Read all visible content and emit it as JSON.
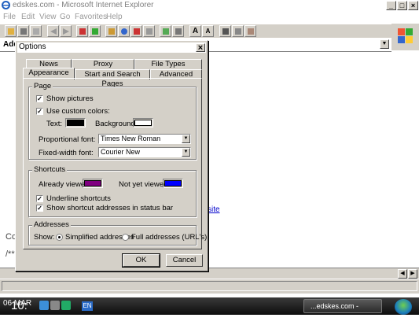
{
  "window": {
    "title": "edskes.com - Microsoft Internet Explorer",
    "min": "_",
    "max": "□",
    "close": "×"
  },
  "menu": [
    "File",
    "Edit",
    "View",
    "Go",
    "Favorites",
    "Help"
  ],
  "toolbar": {
    "font_larger": "A",
    "font_smaller": "A"
  },
  "address": {
    "label": "Add",
    "dropdown": "▼"
  },
  "page": {
    "link_fragment": "site",
    "text1": "Co",
    "text2": "/**"
  },
  "dialog": {
    "title": "Options",
    "close": "×",
    "tabs_back": [
      "News",
      "Proxy",
      "File Types"
    ],
    "tabs_front": [
      "Appearance",
      "Start and Search Pages",
      "Advanced"
    ],
    "page_group": {
      "label": "Page",
      "show_pictures": "Show pictures",
      "use_custom_colors": "Use custom colors:",
      "text_label": "Text:",
      "background_label": "Background:",
      "text_color": "#000000",
      "background_color": "#ffffff",
      "proportional_label": "Proportional font:",
      "proportional_value": "Times New Roman",
      "fixed_label": "Fixed-width font:",
      "fixed_value": "Courier New"
    },
    "shortcuts_group": {
      "label": "Shortcuts",
      "already_viewed": "Already viewed:",
      "not_yet_viewed": "Not yet viewed:",
      "already_color": "#800080",
      "not_yet_color": "#0000ff",
      "underline": "Underline shortcuts",
      "show_addresses": "Show shortcut addresses in status bar"
    },
    "addresses_group": {
      "label": "Addresses",
      "show_label": "Show:",
      "simplified": "Simplified addresses",
      "full": "Full addresses (URL's)"
    },
    "checked_mark": "✓",
    "ok": "OK",
    "cancel": "Cancel"
  },
  "taskbar": {
    "clock_small": "06 MAR",
    "clock_big": "10:",
    "lang": "EN",
    "task_label": "...edskes.com - Micros"
  }
}
